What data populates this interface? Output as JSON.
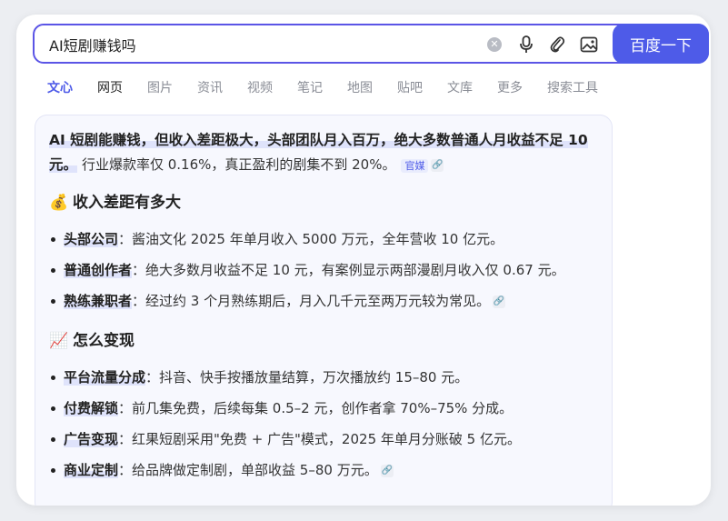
{
  "search": {
    "query": "AI短剧赚钱吗",
    "button_label": "百度一下"
  },
  "tabs": [
    "文心",
    "网页",
    "图片",
    "资讯",
    "视频",
    "笔记",
    "地图",
    "贴吧",
    "文库",
    "更多",
    "搜索工具"
  ],
  "answer": {
    "summary_highlight": "AI 短剧能赚钱，但收入差距极大，头部团队月入百万，绝大多数普通人月收益不足 10 元。",
    "summary_rest": "行业爆款率仅 0.16%，真正盈利的剧集不到 20%。",
    "source_tag": "官媒",
    "sections": [
      {
        "emoji": "💰",
        "title": "收入差距有多大",
        "items": [
          {
            "term": "头部公司",
            "desc": "酱油文化 2025 年单月收入 5000 万元，全年营收 10 亿元。"
          },
          {
            "term": "普通创作者",
            "desc": "绝大多数月收益不足 10 元，有案例显示两部漫剧月收入仅 0.67 元。"
          },
          {
            "term": "熟练兼职者",
            "desc": "经过约 3 个月熟练期后，月入几千元至两万元较为常见。"
          }
        ]
      },
      {
        "emoji": "📈",
        "title": "怎么变现",
        "items": [
          {
            "term": "平台流量分成",
            "desc": "抖音、快手按播放量结算，万次播放约 15–80 元。"
          },
          {
            "term": "付费解锁",
            "desc": "前几集免费，后续每集 0.5–2 元，创作者拿 70%–75% 分成。"
          },
          {
            "term": "广告变现",
            "desc": "红果短剧采用\"免费 + 广告\"模式，2025 年单月分账破 5 亿元。"
          },
          {
            "term": "商业定制",
            "desc": "给品牌做定制剧，单部收益 5–80 万元。"
          }
        ]
      }
    ]
  },
  "colors": {
    "accent": "#4e5be8",
    "highlight": "#dfe3fb",
    "card_bg": "#f7f8fe"
  }
}
